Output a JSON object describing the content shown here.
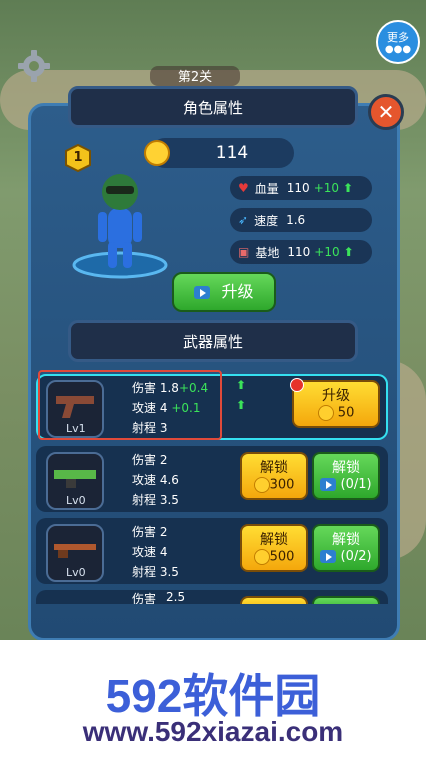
{
  "hud": {
    "more_label": "更多",
    "level_label": "第2关"
  },
  "panel": {
    "title": "角色属性",
    "rank": "1",
    "coins": "114",
    "stats": [
      {
        "label": "血量",
        "value": "110",
        "bonus": "+10"
      },
      {
        "label": "速度",
        "value": "1.6",
        "bonus": ""
      },
      {
        "label": "基地",
        "value": "110",
        "bonus": "+10"
      }
    ],
    "upgrade_label": "升级",
    "weapon_title": "武器属性",
    "weapons": [
      {
        "lv": "Lv1",
        "stats": [
          {
            "k": "伤害",
            "v": "1.8",
            "b": "+0.4"
          },
          {
            "k": "攻速",
            "v": "4",
            "b": "+0.1"
          },
          {
            "k": "射程",
            "v": "3",
            "b": ""
          }
        ],
        "btn1": {
          "label": "升级",
          "price": "50"
        }
      },
      {
        "lv": "Lv0",
        "stats": [
          {
            "k": "伤害",
            "v": "2",
            "b": ""
          },
          {
            "k": "攻速",
            "v": "4.6",
            "b": ""
          },
          {
            "k": "射程",
            "v": "3.5",
            "b": ""
          }
        ],
        "btn1": {
          "label": "解锁",
          "price": "300"
        },
        "btn2": {
          "label": "解锁",
          "ad": "(0/1)"
        }
      },
      {
        "lv": "Lv0",
        "stats": [
          {
            "k": "伤害",
            "v": "2",
            "b": ""
          },
          {
            "k": "攻速",
            "v": "4",
            "b": ""
          },
          {
            "k": "射程",
            "v": "3.5",
            "b": ""
          }
        ],
        "btn1": {
          "label": "解锁",
          "price": "500"
        },
        "btn2": {
          "label": "解锁",
          "ad": "(0/2)"
        }
      },
      {
        "stats": [
          {
            "k": "伤害",
            "v": "2.5"
          }
        ]
      }
    ]
  },
  "watermark": {
    "brand": "592软件园",
    "url": "www.592xiazai.com"
  },
  "colors": {
    "panel": "#2d5d8b",
    "highlight": "#e04a3a",
    "cyan": "#35e0f0",
    "bonus": "#3be35a"
  }
}
